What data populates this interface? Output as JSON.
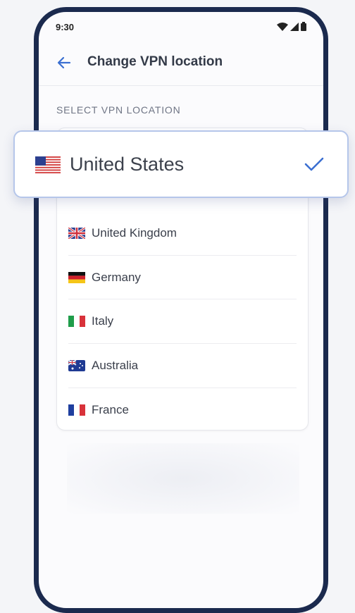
{
  "status_bar": {
    "time": "9:30",
    "icons": [
      "wifi-icon",
      "signal-icon",
      "battery-icon"
    ]
  },
  "app_bar": {
    "back_icon": "arrow-left-icon",
    "title": "Change VPN location"
  },
  "section_label": "SELECT VPN LOCATION",
  "selected": {
    "name": "United States",
    "flag": "us-flag-icon",
    "check_icon": "check-icon"
  },
  "countries": [
    {
      "name": "United Kingdom",
      "flag": "uk-flag-icon"
    },
    {
      "name": "Germany",
      "flag": "germany-flag-icon"
    },
    {
      "name": "Italy",
      "flag": "italy-flag-icon"
    },
    {
      "name": "Australia",
      "flag": "australia-flag-icon"
    },
    {
      "name": "France",
      "flag": "france-flag-icon"
    }
  ],
  "colors": {
    "accent": "#3b6fd1",
    "frame": "#1b2a4e"
  }
}
